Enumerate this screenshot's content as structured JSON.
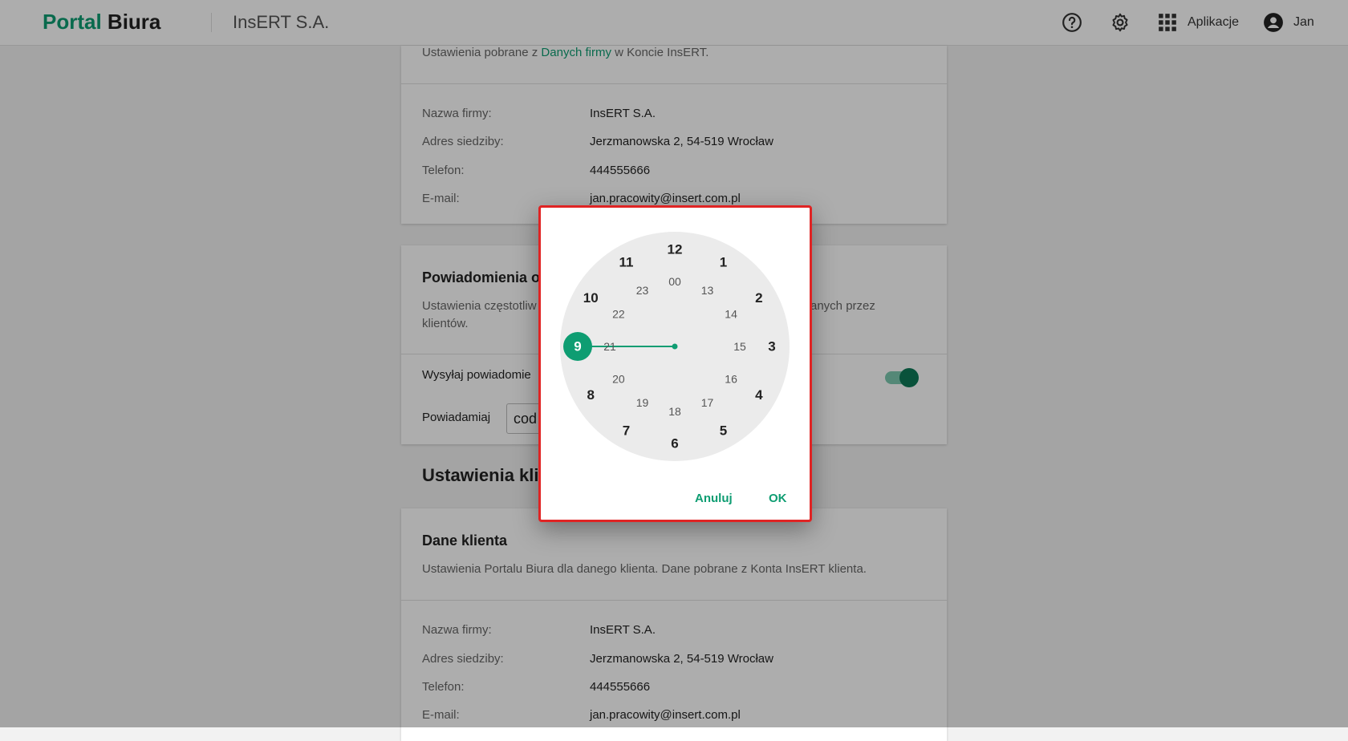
{
  "topbar": {
    "logo_part1": "Portal",
    "logo_part2": "Biura",
    "company": "InsERT S.A.",
    "help_icon": "help-circle-icon",
    "settings_icon": "gear-icon",
    "apps_icon": "apps-grid-icon",
    "apps_label": "Aplikacje",
    "user_icon": "account-circle-icon",
    "user_name": "Jan"
  },
  "company_card": {
    "source_prefix": "Ustawienia pobrane z ",
    "source_link": "Danych firmy",
    "source_suffix": " w Koncie InsERT.",
    "rows": [
      {
        "label": "Nazwa firmy:",
        "value": "InsERT S.A."
      },
      {
        "label": "Adres siedziby:",
        "value": "Jerzmanowska 2, 54-519 Wrocław"
      },
      {
        "label": "Telefon:",
        "value": "444555666"
      },
      {
        "label": "E-mail:",
        "value": "jan.pracowity@insert.com.pl"
      }
    ]
  },
  "notifications_card": {
    "title": "Powiadomienia o",
    "desc_line1_left": "Ustawienia częstotliw",
    "desc_line1_right": "anych przez",
    "desc_line2": "klientów.",
    "send_label": "Wysyłaj powiadomie",
    "toggle_on": true,
    "notify_label": "Powiadamiaj",
    "notify_value": "cod"
  },
  "client_settings": {
    "section_title": "Ustawienia kli"
  },
  "client_card": {
    "title": "Dane klienta",
    "desc": "Ustawienia Portalu Biura dla danego klienta. Dane pobrane z Konta InsERT klienta.",
    "rows": [
      {
        "label": "Nazwa firmy:",
        "value": "InsERT S.A."
      },
      {
        "label": "Adres siedziby:",
        "value": "Jerzmanowska 2, 54-519 Wrocław"
      },
      {
        "label": "Telefon:",
        "value": "444555666"
      },
      {
        "label": "E-mail:",
        "value": "jan.pracowity@insert.com.pl"
      }
    ]
  },
  "time_picker": {
    "outer_hours": [
      "12",
      "1",
      "2",
      "3",
      "4",
      "5",
      "6",
      "7",
      "8",
      "9",
      "10",
      "11"
    ],
    "inner_hours": [
      "00",
      "13",
      "14",
      "15",
      "16",
      "17",
      "18",
      "19",
      "20",
      "21",
      "22",
      "23"
    ],
    "selected_hour": "9",
    "cancel_label": "Anuluj",
    "ok_label": "OK",
    "accent_color": "#0e9d72"
  }
}
